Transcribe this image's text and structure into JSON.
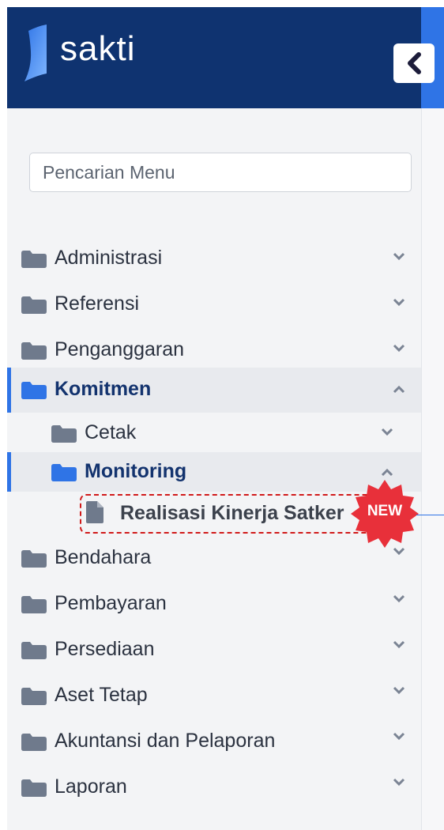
{
  "app": {
    "title": "sakti"
  },
  "search": {
    "placeholder": "Pencarian Menu",
    "value": ""
  },
  "menu": [
    {
      "label": "Administrasi",
      "icon": "folder-icon",
      "state": "collapsed"
    },
    {
      "label": "Referensi",
      "icon": "folder-icon",
      "state": "collapsed"
    },
    {
      "label": "Penganggaran",
      "icon": "folder-icon",
      "state": "collapsed"
    },
    {
      "label": "Komitmen",
      "icon": "folder-icon",
      "state": "expanded",
      "active": true
    },
    {
      "label": "Cetak",
      "icon": "folder-icon",
      "state": "collapsed"
    },
    {
      "label": "Monitoring",
      "icon": "folder-icon",
      "state": "expanded",
      "active": true
    },
    {
      "label": "Realisasi Kinerja Satker",
      "icon": "file-icon",
      "badge": "NEW"
    },
    {
      "label": "Bendahara",
      "icon": "folder-icon",
      "state": "collapsed"
    },
    {
      "label": "Pembayaran",
      "icon": "folder-icon",
      "state": "collapsed"
    },
    {
      "label": "Persediaan",
      "icon": "folder-icon",
      "state": "collapsed"
    },
    {
      "label": "Aset Tetap",
      "icon": "folder-icon",
      "state": "collapsed"
    },
    {
      "label": "Akuntansi dan Pelaporan",
      "icon": "folder-icon",
      "state": "collapsed"
    },
    {
      "label": "Laporan",
      "icon": "folder-icon",
      "state": "collapsed"
    }
  ],
  "colors": {
    "header": "#0f3370",
    "accent": "#2f74e6",
    "active_text": "#13336e",
    "badge": "#e8303a"
  }
}
